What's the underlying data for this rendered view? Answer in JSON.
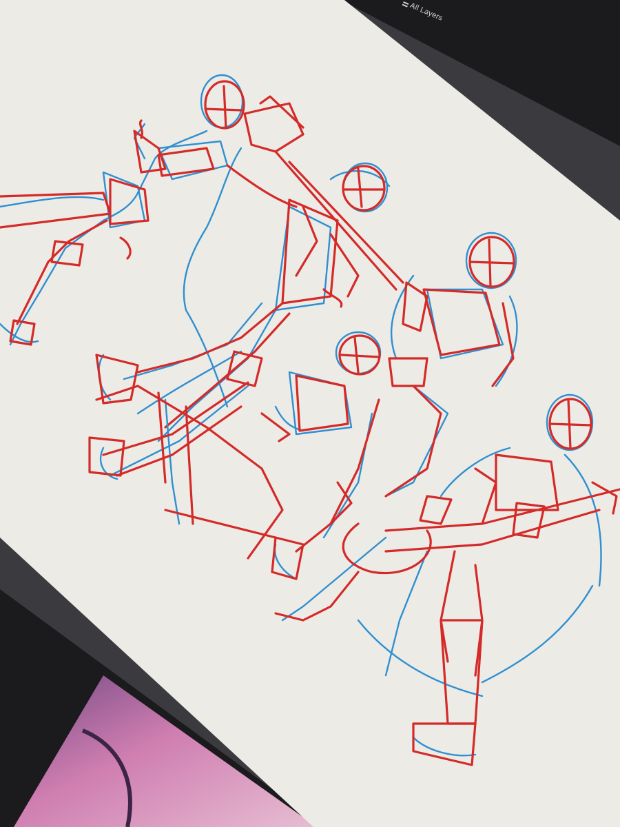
{
  "toolbar": {
    "layers_label": "All Layers"
  },
  "colors": {
    "background": "#1b1b1d",
    "device_frame": "#3a3a3f",
    "canvas": "#ecebe6",
    "sketch_red": "#d42a28",
    "sketch_blue": "#2f8fd0",
    "print_pink": "#d883b8",
    "print_purple": "#7a4c8a"
  },
  "icons": {
    "layers": "layers-icon"
  },
  "scene": {
    "figure_count": 5,
    "drawing_layers": [
      "red-construction-sketch",
      "blue-line-sketch"
    ]
  }
}
